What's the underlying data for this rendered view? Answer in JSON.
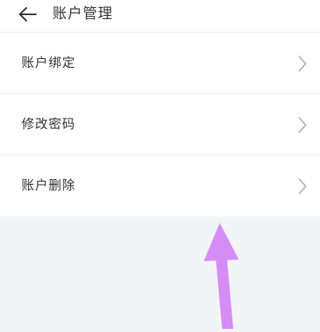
{
  "header": {
    "back_icon": "arrow-left-icon",
    "title": "账户管理"
  },
  "menu": {
    "items": [
      {
        "label": "账户绑定",
        "icon": "chevron-right-icon"
      },
      {
        "label": "修改密码",
        "icon": "chevron-right-icon"
      },
      {
        "label": "账户删除",
        "icon": "chevron-right-icon"
      }
    ]
  },
  "overlay": {
    "arrow_icon": "annotation-arrow-up-icon",
    "arrow_color": "#d68cf6"
  },
  "colors": {
    "background": "#f3f4f5",
    "surface": "#ffffff",
    "divider": "#eeeeee",
    "text": "#333333",
    "chevron": "#aaaaaa"
  }
}
